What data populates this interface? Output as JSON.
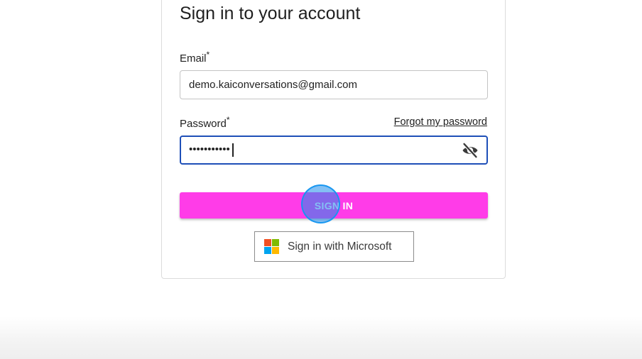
{
  "form": {
    "title": "Sign in to your account",
    "email": {
      "label": "Email",
      "required_mark": "*",
      "value": "demo.kaiconversations@gmail.com"
    },
    "password": {
      "label": "Password",
      "required_mark": "*",
      "masked_value": "•••••••••••",
      "visibility_icon": "eye-off-icon"
    },
    "forgot_password_link": "Forgot my password",
    "sign_in_button": "SIGN IN",
    "microsoft_button": {
      "label": "Sign in with Microsoft",
      "icon": "microsoft-logo"
    }
  },
  "colors": {
    "sign_in_button_bg": "#ff3ce8",
    "focused_input_border": "#1e4fb8",
    "click_indicator": "#1e8ceb",
    "microsoft_red": "#f25022",
    "microsoft_green": "#7fba00",
    "microsoft_blue": "#00a4ef",
    "microsoft_yellow": "#ffb900"
  }
}
